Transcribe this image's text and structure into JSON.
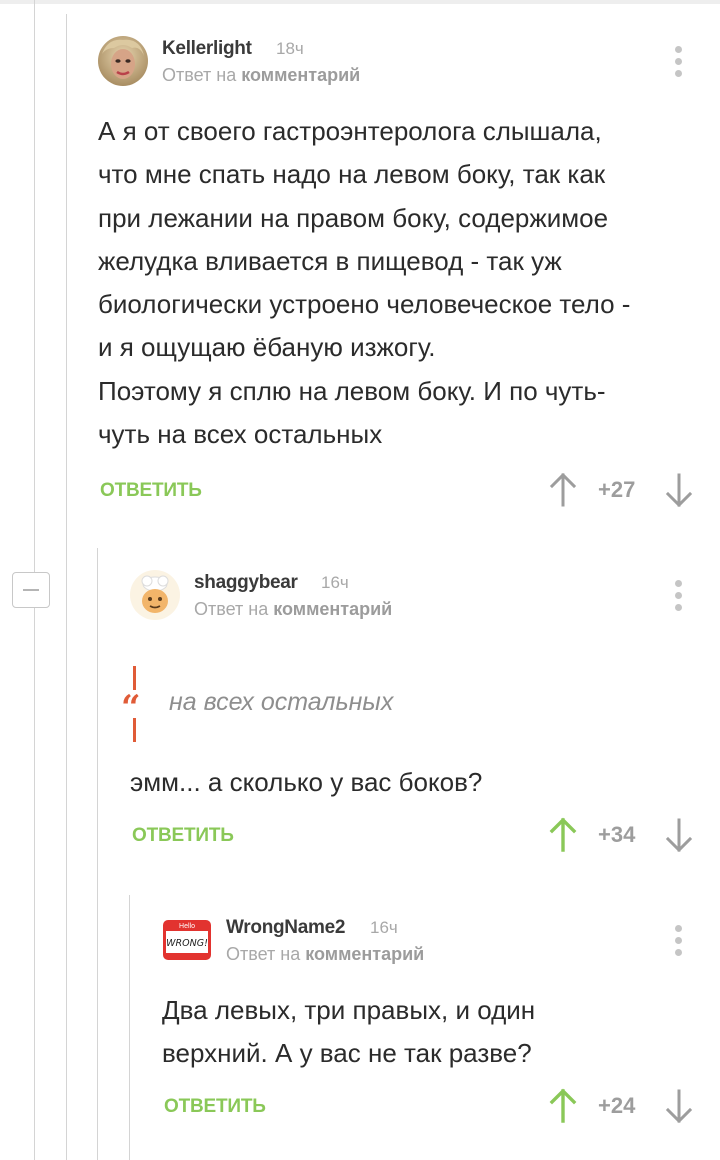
{
  "comments": [
    {
      "author": "Kellerlight",
      "time": "18ч",
      "reply_prefix": "Ответ на",
      "reply_link": "комментарий",
      "lines": [
        "А я от своего гастроэнтеролога слышала,",
        "что мне спать надо на левом боку, так как",
        "при лежании на правом боку, содержимое",
        "желудка вливается в пищевод - так уж",
        "биологически устроено человеческое тело -",
        "и я ощущаю ёбаную изжогу.",
        "Поэтому я сплю на левом боку. И по чуть-",
        "чуть на всех остальных"
      ],
      "answer_label": "ОТВЕТИТЬ",
      "score": "+27",
      "upvoted": false
    },
    {
      "author": "shaggybear",
      "time": "16ч",
      "reply_prefix": "Ответ на",
      "reply_link": "комментарий",
      "quote_mark": "“",
      "quote": "на всех остальных",
      "lines": [
        "эмм... а сколько у вас боков?"
      ],
      "answer_label": "ОТВЕТИТЬ",
      "score": "+34",
      "upvoted": true
    },
    {
      "author": "WrongName2",
      "time": "16ч",
      "reply_prefix": "Ответ на",
      "reply_link": "комментарий",
      "avatar_text_top": "Hello",
      "avatar_text": "WRONG!",
      "lines": [
        "Два левых, три правых, и один",
        "верхний. А у вас не так разве?"
      ],
      "answer_label": "ОТВЕТИТЬ",
      "score": "+24",
      "upvoted": true
    }
  ],
  "colors": {
    "accent_green": "#8ac858",
    "quote_red": "#e05b37",
    "muted_gray": "#a8a8a8",
    "text": "#2b2b2b"
  },
  "icons": {
    "vote_up": "arrow-up-icon",
    "vote_down": "arrow-down-icon",
    "menu": "more-vertical-icon",
    "collapse": "minus-icon",
    "quote": "quote-icon"
  }
}
